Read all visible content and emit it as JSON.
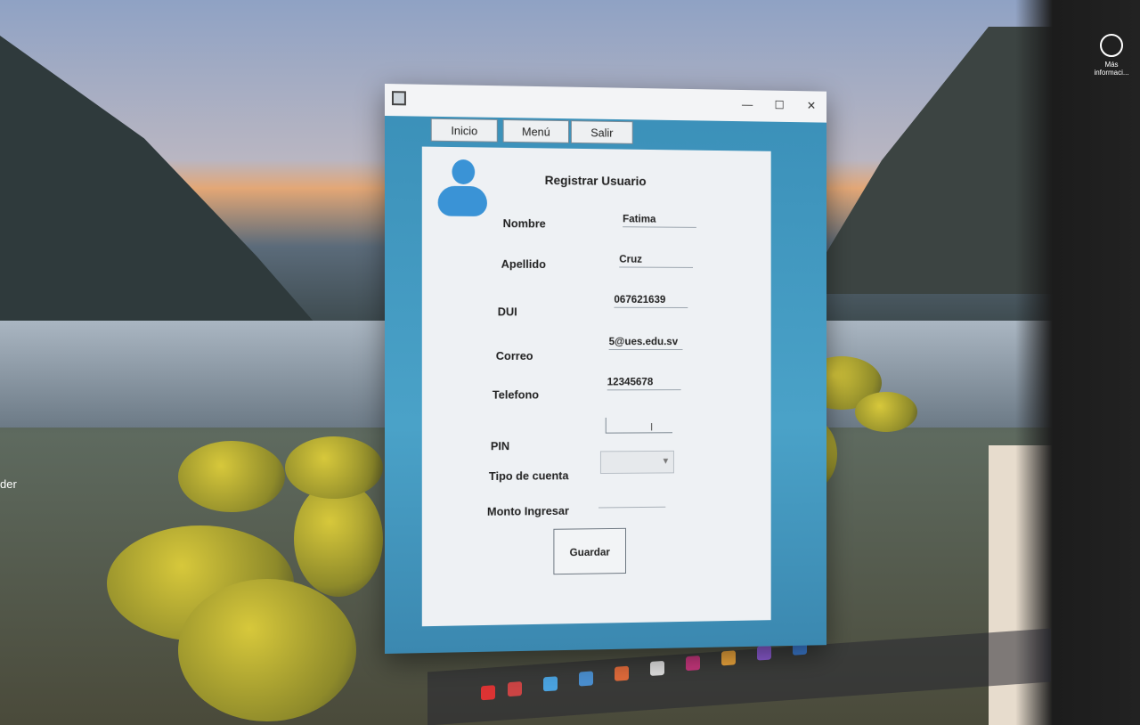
{
  "desktop": {
    "icon_label": "Más informaci...",
    "left_label": "der"
  },
  "window": {
    "minimize": "—",
    "maximize": "☐",
    "close": "✕"
  },
  "nav": {
    "inicio": "Inicio",
    "menu": "Menú",
    "salir": "Salir"
  },
  "form": {
    "title": "Registrar Usuario",
    "fields": [
      {
        "label": "Nombre",
        "value": "Fatima"
      },
      {
        "label": "Apellido",
        "value": "Cruz"
      },
      {
        "label": "DUI",
        "value": "067621639"
      },
      {
        "label": "Correo",
        "value": "5@ues.edu.sv"
      },
      {
        "label": "Telefono",
        "value": "12345678"
      }
    ],
    "pin_label": "PIN",
    "tipo_label": "Tipo de cuenta",
    "monto_label": "Monto Ingresar",
    "save_label": "Guardar"
  },
  "icons": [
    "app-icon",
    "user-avatar-icon",
    "chevron-down-icon"
  ]
}
